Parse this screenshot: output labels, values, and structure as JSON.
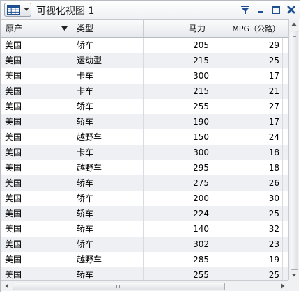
{
  "window": {
    "title": "可视化视图 1"
  },
  "toolbar": {
    "visualization_type": "table-icon",
    "filter_icon": "filter-icon",
    "minimize_icon": "minimize-icon",
    "maximize_icon": "maximize-icon",
    "close_icon": "close-icon"
  },
  "table": {
    "columns": [
      {
        "label": "原产",
        "align": "left",
        "sorted": "descending"
      },
      {
        "label": "类型",
        "align": "left"
      },
      {
        "label": "马力",
        "align": "right"
      },
      {
        "label": "MPG（公路）",
        "align": "right"
      }
    ],
    "rows": [
      [
        "美国",
        "轿车",
        "205",
        "29"
      ],
      [
        "美国",
        "运动型",
        "215",
        "25"
      ],
      [
        "美国",
        "卡车",
        "300",
        "17"
      ],
      [
        "美国",
        "卡车",
        "215",
        "21"
      ],
      [
        "美国",
        "轿车",
        "255",
        "27"
      ],
      [
        "美国",
        "轿车",
        "190",
        "17"
      ],
      [
        "美国",
        "越野车",
        "150",
        "24"
      ],
      [
        "美国",
        "卡车",
        "300",
        "18"
      ],
      [
        "美国",
        "越野车",
        "295",
        "18"
      ],
      [
        "美国",
        "轿车",
        "275",
        "26"
      ],
      [
        "美国",
        "轿车",
        "200",
        "30"
      ],
      [
        "美国",
        "轿车",
        "224",
        "25"
      ],
      [
        "美国",
        "轿车",
        "140",
        "32"
      ],
      [
        "美国",
        "轿车",
        "302",
        "23"
      ],
      [
        "美国",
        "越野车",
        "285",
        "19"
      ],
      [
        "美国",
        "轿车",
        "255",
        "25"
      ]
    ]
  },
  "colors": {
    "row_alt": "#eef0f3",
    "accent": "#1d4f91",
    "header_bg": "#e6e9ed"
  }
}
